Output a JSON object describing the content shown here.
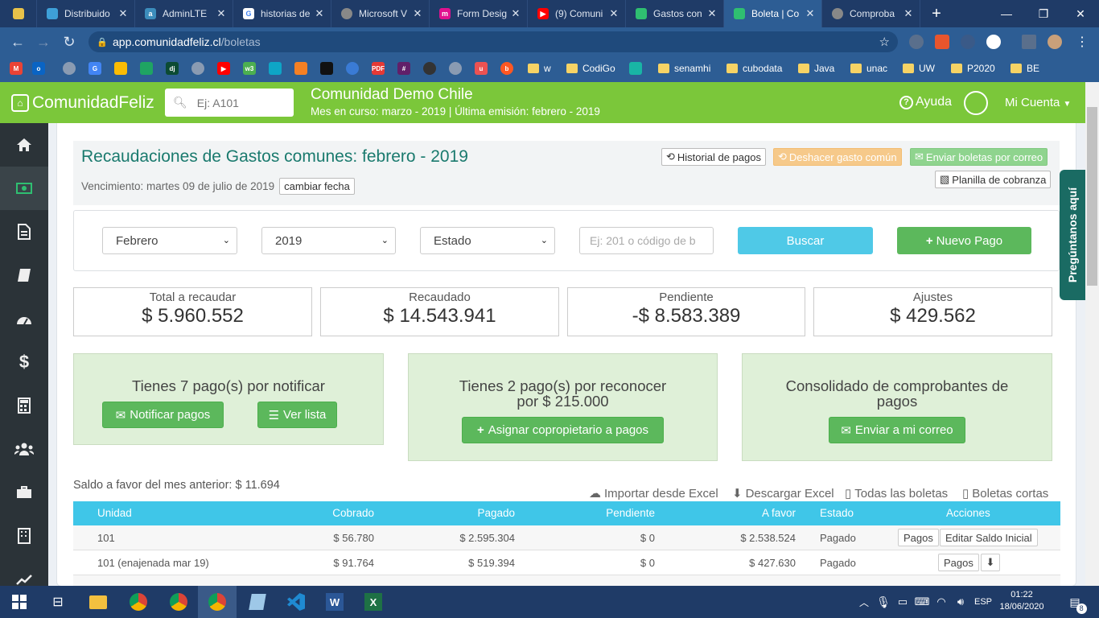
{
  "browser": {
    "tabs": [
      {
        "label": "Distribuido",
        "color": "#3ea0d8"
      },
      {
        "label": "AdminLTE",
        "color": "#3c8dbc"
      },
      {
        "label": "historias de",
        "color": "#ffffff"
      },
      {
        "label": "Microsoft V",
        "color": "#888888"
      },
      {
        "label": "Form Desig",
        "color": "#e0118f"
      },
      {
        "label": "(9) Comuni",
        "color": "#ff0000"
      },
      {
        "label": "Gastos con",
        "color": "#2fbf71"
      },
      {
        "label": "Boleta | Co",
        "color": "#2fbf71"
      },
      {
        "label": "Comproba",
        "color": "#888888"
      }
    ],
    "url_host": "app.comunidadfeliz.cl",
    "url_path": "/boletas",
    "bookmarks": [
      "w",
      "CodiGo",
      "senamhi",
      "cubodata",
      "Java",
      "unac",
      "UW",
      "P2020",
      "BE"
    ]
  },
  "header": {
    "logo": "ComunidadFeliz",
    "search_placeholder": "Ej: A101",
    "community": "Comunidad Demo Chile",
    "period": "Mes en curso: marzo - 2019 | Última emisión: febrero - 2019",
    "help": "Ayuda",
    "account": "Mi Cuenta"
  },
  "page": {
    "title": "Recaudaciones de Gastos comunes: febrero - 2019",
    "due": "Vencimiento: martes 09 de julio de 2019",
    "change_date": "cambiar fecha",
    "history_btn": "Historial de pagos",
    "undo_btn": "Deshacer gasto común",
    "send_btn": "Enviar boletas por correo",
    "sheet_btn": "Planilla de cobranza"
  },
  "filters": {
    "month": "Febrero",
    "year": "2019",
    "status": "Estado",
    "number_placeholder": "Ej: 201 o código de b",
    "search": "Buscar",
    "new_payment": "Nuevo Pago"
  },
  "stats": [
    {
      "label": "Total a recaudar",
      "value": "$ 5.960.552"
    },
    {
      "label": "Recaudado",
      "value": "$ 14.543.941"
    },
    {
      "label": "Pendiente",
      "value": "-$ 8.583.389"
    },
    {
      "label": "Ajustes",
      "value": "$ 429.562"
    }
  ],
  "cards": {
    "notify_title": "Tienes 7 pago(s) por notificar",
    "notify_btn": "Notificar pagos",
    "list_btn": "Ver lista",
    "recognize_title_1": "Tienes 2 pago(s) por reconocer",
    "recognize_title_2": "por $ 215.000",
    "assign_btn": "Asignar copropietario a pagos",
    "consolidated_title_1": "Consolidado de comprobantes de",
    "consolidated_title_2": "pagos",
    "email_btn": "Enviar a mi correo"
  },
  "table": {
    "saldo": "Saldo a favor del mes anterior: $ 11.694",
    "links": [
      "Importar desde Excel",
      "Descargar Excel",
      "Todas las boletas",
      "Boletas cortas"
    ],
    "headers": [
      "Unidad",
      "Cobrado",
      "Pagado",
      "Pendiente",
      "A favor",
      "Estado",
      "Acciones"
    ],
    "rows": [
      {
        "unidad": "101",
        "cobrado": "$ 56.780",
        "pagado": "$ 2.595.304",
        "pendiente": "$ 0",
        "afavor": "$ 2.538.524",
        "estado": "Pagado",
        "btn1": "Pagos",
        "btn2": "Editar Saldo Inicial"
      },
      {
        "unidad": "101 (enajenada mar 19)",
        "cobrado": "$ 91.764",
        "pagado": "$ 519.394",
        "pendiente": "$ 0",
        "afavor": "$ 427.630",
        "estado": "Pagado",
        "btn1": "Pagos",
        "btn2": ""
      }
    ]
  },
  "side_tab": "Pregúntanos aquí",
  "taskbar": {
    "lang": "ESP",
    "time": "01:22",
    "date": "18/06/2020",
    "notifications": "8"
  },
  "colors": {
    "app_green": "#7bc73a",
    "teal_title": "#1a7a6e",
    "table_header": "#3fc6e8",
    "button_green": "#5cb85c",
    "button_blue": "#4fc9e7"
  }
}
